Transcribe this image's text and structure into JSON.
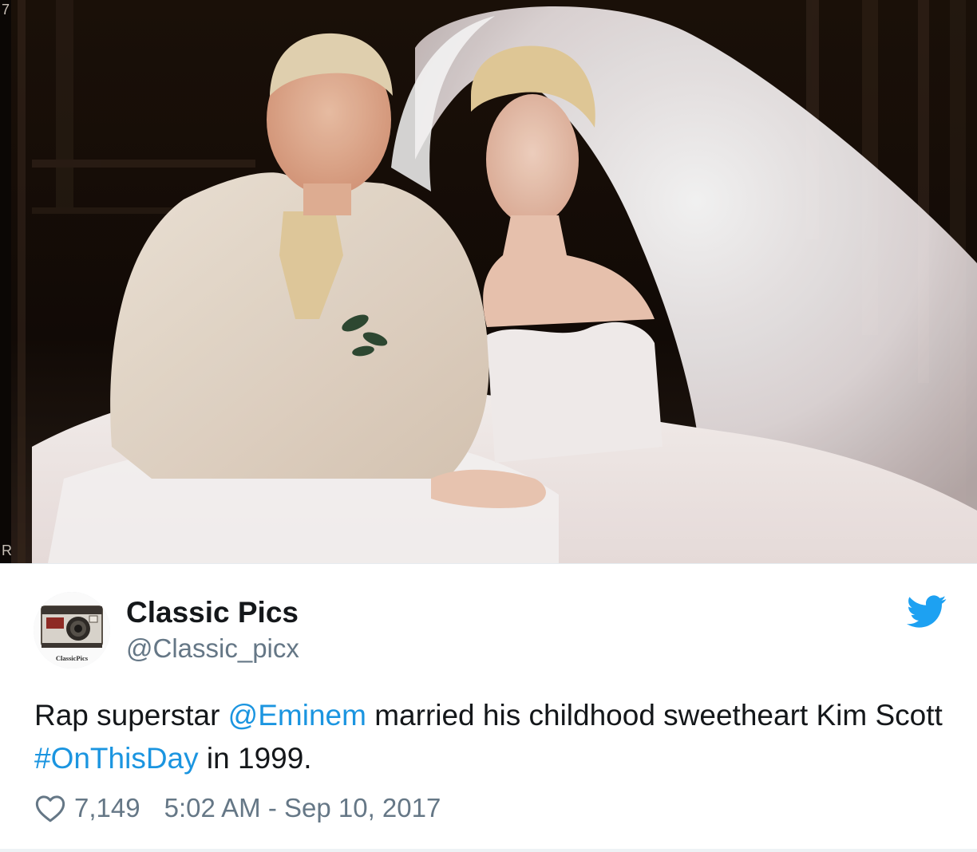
{
  "photo": {
    "description_icon": "wedding-photo",
    "corner_marks": [
      "7",
      "R"
    ]
  },
  "author": {
    "display_name": "Classic Pics",
    "handle": "@Classic_picx",
    "avatar_caption": "ClassicPics",
    "avatar_icon": "camera-icon"
  },
  "brand": {
    "icon": "twitter-bird-icon",
    "color": "#1da1f2"
  },
  "tweet": {
    "text_parts": [
      {
        "text": "Rap superstar ",
        "type": "text"
      },
      {
        "text": "@Eminem",
        "type": "mention"
      },
      {
        "text": " married his childhood sweetheart Kim Scott ",
        "type": "text"
      },
      {
        "text": "#OnThisDay",
        "type": "hashtag"
      },
      {
        "text": " in 1999.",
        "type": "text"
      }
    ],
    "link_color": "#1b95e0"
  },
  "footer": {
    "like_icon": "heart-icon",
    "like_count": "7,149",
    "timestamp": "5:02 AM - Sep 10, 2017"
  }
}
